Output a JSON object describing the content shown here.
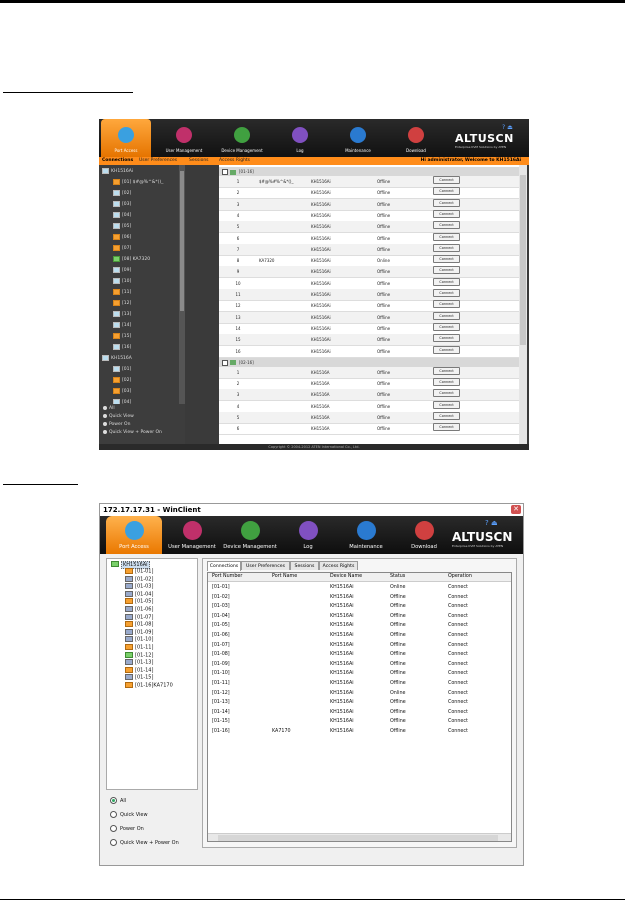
{
  "colors": {
    "accent": "#ff8c1a",
    "dark_bar": "#1a1a1a",
    "button_border": "#7a7a7a"
  },
  "headings": {
    "first": "",
    "second": ""
  },
  "browser": {
    "tabs": [
      {
        "label": "Port Access",
        "icon": "monitor-icon",
        "color": "#3aa0e0"
      },
      {
        "label": "User Management",
        "icon": "users-icon",
        "color": "#c0306a"
      },
      {
        "label": "Device Management",
        "icon": "device-icon",
        "color": "#40a040"
      },
      {
        "label": "Log",
        "icon": "log-icon",
        "color": "#8050c0"
      },
      {
        "label": "Maintenance",
        "icon": "maintenance-icon",
        "color": "#2a7ad0"
      },
      {
        "label": "Download",
        "icon": "download-icon",
        "color": "#d04040"
      }
    ],
    "logo": "ALTUSCN",
    "logo_tag": "Enterprise KVM Solutions by ATEN",
    "subtabs": [
      "Connections",
      "User Preferences",
      "Sessions",
      "Access Rights"
    ],
    "welcome": "Hi administrator, Welcome to KH1516Ai",
    "tree": [
      {
        "label": "KH1516Ai",
        "type": "root"
      },
      {
        "label": "[01] $#@%^&*()_",
        "type": "or"
      },
      {
        "label": "[02]",
        "type": "pc"
      },
      {
        "label": "[03]",
        "type": "pc"
      },
      {
        "label": "[04]",
        "type": "pc"
      },
      {
        "label": "[05]",
        "type": "pc"
      },
      {
        "label": "[06]",
        "type": "or"
      },
      {
        "label": "[07]",
        "type": "or"
      },
      {
        "label": "[08] KA7320",
        "type": "gr"
      },
      {
        "label": "[09]",
        "type": "pc"
      },
      {
        "label": "[10]",
        "type": "pc"
      },
      {
        "label": "[11]",
        "type": "or"
      },
      {
        "label": "[12]",
        "type": "or"
      },
      {
        "label": "[13]",
        "type": "pc"
      },
      {
        "label": "[14]",
        "type": "pc"
      },
      {
        "label": "[15]",
        "type": "or"
      },
      {
        "label": "[16]",
        "type": "pc"
      },
      {
        "label": "KH1516A",
        "type": "root"
      },
      {
        "label": "[01]",
        "type": "pc"
      },
      {
        "label": "[02]",
        "type": "or"
      },
      {
        "label": "[03]",
        "type": "or"
      },
      {
        "label": "[04]",
        "type": "pc"
      }
    ],
    "radios": [
      "All",
      "Quick View",
      "Power On",
      "Quick View + Power On"
    ],
    "group1": "[01-16]",
    "group2": "[02-16]",
    "rows1": [
      {
        "port": "1",
        "name": "$#@%#%^&*()_",
        "device": "KH1516Ai",
        "status": "Offline",
        "op": "Connect"
      },
      {
        "port": "2",
        "name": "",
        "device": "KH1516Ai",
        "status": "Offline",
        "op": "Connect"
      },
      {
        "port": "3",
        "name": "",
        "device": "KH1516Ai",
        "status": "Offline",
        "op": "Connect"
      },
      {
        "port": "4",
        "name": "",
        "device": "KH1516Ai",
        "status": "Offline",
        "op": "Connect"
      },
      {
        "port": "5",
        "name": "",
        "device": "KH1516Ai",
        "status": "Offline",
        "op": "Connect"
      },
      {
        "port": "6",
        "name": "",
        "device": "KH1516Ai",
        "status": "Offline",
        "op": "Connect"
      },
      {
        "port": "7",
        "name": "",
        "device": "KH1516Ai",
        "status": "Offline",
        "op": "Connect"
      },
      {
        "port": "8",
        "name": "KA7320",
        "device": "KH1516Ai",
        "status": "Online",
        "op": "Connect"
      },
      {
        "port": "9",
        "name": "",
        "device": "KH1516Ai",
        "status": "Offline",
        "op": "Connect"
      },
      {
        "port": "10",
        "name": "",
        "device": "KH1516Ai",
        "status": "Offline",
        "op": "Connect"
      },
      {
        "port": "11",
        "name": "",
        "device": "KH1516Ai",
        "status": "Offline",
        "op": "Connect"
      },
      {
        "port": "12",
        "name": "",
        "device": "KH1516Ai",
        "status": "Offline",
        "op": "Connect"
      },
      {
        "port": "13",
        "name": "",
        "device": "KH1516Ai",
        "status": "Offline",
        "op": "Connect"
      },
      {
        "port": "14",
        "name": "",
        "device": "KH1516Ai",
        "status": "Offline",
        "op": "Connect"
      },
      {
        "port": "15",
        "name": "",
        "device": "KH1516Ai",
        "status": "Offline",
        "op": "Connect"
      },
      {
        "port": "16",
        "name": "",
        "device": "KH1516Ai",
        "status": "Offline",
        "op": "Connect"
      }
    ],
    "rows2": [
      {
        "port": "1",
        "name": "",
        "device": "KH1516A",
        "status": "Offline",
        "op": "Connect"
      },
      {
        "port": "2",
        "name": "",
        "device": "KH1516A",
        "status": "Offline",
        "op": "Connect"
      },
      {
        "port": "3",
        "name": "",
        "device": "KH1516A",
        "status": "Offline",
        "op": "Connect"
      },
      {
        "port": "4",
        "name": "",
        "device": "KH1516A",
        "status": "Offline",
        "op": "Connect"
      },
      {
        "port": "5",
        "name": "",
        "device": "KH1516A",
        "status": "Offline",
        "op": "Connect"
      },
      {
        "port": "6",
        "name": "",
        "device": "KH1516A",
        "status": "Offline",
        "op": "Connect"
      }
    ],
    "footer": "Copyright © 2004-2012 ATEN International Co., Ltd."
  },
  "winclient": {
    "title": "172.17.17.31 - WinClient",
    "tabs": [
      {
        "label": "Port Access",
        "icon": "monitor-icon",
        "color": "#3aa0e0"
      },
      {
        "label": "User Management",
        "icon": "users-icon",
        "color": "#c0306a"
      },
      {
        "label": "Device Management",
        "icon": "device-icon",
        "color": "#40a040"
      },
      {
        "label": "Log",
        "icon": "log-icon",
        "color": "#8050c0"
      },
      {
        "label": "Maintenance",
        "icon": "maintenance-icon",
        "color": "#2a7ad0"
      },
      {
        "label": "Download",
        "icon": "download-icon",
        "color": "#d04040"
      }
    ],
    "logo": "ALTUSCN",
    "logo_tag": "Enterprise KVM Solutions by ATEN",
    "tree_root": "KH1516Ai",
    "tree": [
      {
        "label": "[01-01]",
        "type": "or"
      },
      {
        "label": "[01-02]",
        "type": "pc"
      },
      {
        "label": "[01-03]",
        "type": "pc"
      },
      {
        "label": "[01-04]",
        "type": "pc"
      },
      {
        "label": "[01-05]",
        "type": "or"
      },
      {
        "label": "[01-06]",
        "type": "pc"
      },
      {
        "label": "[01-07]",
        "type": "pc"
      },
      {
        "label": "[01-08]",
        "type": "or"
      },
      {
        "label": "[01-09]",
        "type": "pc"
      },
      {
        "label": "[01-10]",
        "type": "pc"
      },
      {
        "label": "[01-11]",
        "type": "or"
      },
      {
        "label": "[01-12]",
        "type": "gr"
      },
      {
        "label": "[01-13]",
        "type": "pc"
      },
      {
        "label": "[01-14]",
        "type": "or"
      },
      {
        "label": "[01-15]",
        "type": "pc"
      },
      {
        "label": "[01-16]KA7170",
        "type": "or"
      }
    ],
    "radios": [
      "All",
      "Quick View",
      "Power On",
      "Quick View + Power On"
    ],
    "subtabs": [
      "Connections",
      "User Preferences",
      "Sessions",
      "Access Rights"
    ],
    "columns": [
      "Port Number",
      "Port Name",
      "Device Name",
      "Status",
      "Operation"
    ],
    "rows": [
      {
        "port": "[01-01]",
        "name": "",
        "device": "KH1516Ai",
        "status": "Online",
        "op": "Connect"
      },
      {
        "port": "[01-02]",
        "name": "",
        "device": "KH1516Ai",
        "status": "Offline",
        "op": "Connect"
      },
      {
        "port": "[01-03]",
        "name": "",
        "device": "KH1516Ai",
        "status": "Offline",
        "op": "Connect"
      },
      {
        "port": "[01-04]",
        "name": "",
        "device": "KH1516Ai",
        "status": "Offline",
        "op": "Connect"
      },
      {
        "port": "[01-05]",
        "name": "",
        "device": "KH1516Ai",
        "status": "Offline",
        "op": "Connect"
      },
      {
        "port": "[01-06]",
        "name": "",
        "device": "KH1516Ai",
        "status": "Offline",
        "op": "Connect"
      },
      {
        "port": "[01-07]",
        "name": "",
        "device": "KH1516Ai",
        "status": "Offline",
        "op": "Connect"
      },
      {
        "port": "[01-08]",
        "name": "",
        "device": "KH1516Ai",
        "status": "Offline",
        "op": "Connect"
      },
      {
        "port": "[01-09]",
        "name": "",
        "device": "KH1516Ai",
        "status": "Offline",
        "op": "Connect"
      },
      {
        "port": "[01-10]",
        "name": "",
        "device": "KH1516Ai",
        "status": "Offline",
        "op": "Connect"
      },
      {
        "port": "[01-11]",
        "name": "",
        "device": "KH1516Ai",
        "status": "Offline",
        "op": "Connect"
      },
      {
        "port": "[01-12]",
        "name": "",
        "device": "KH1516Ai",
        "status": "Online",
        "op": "Connect"
      },
      {
        "port": "[01-13]",
        "name": "",
        "device": "KH1516Ai",
        "status": "Offline",
        "op": "Connect"
      },
      {
        "port": "[01-14]",
        "name": "",
        "device": "KH1516Ai",
        "status": "Offline",
        "op": "Connect"
      },
      {
        "port": "[01-15]",
        "name": "",
        "device": "KH1516Ai",
        "status": "Offline",
        "op": "Connect"
      },
      {
        "port": "[01-16]",
        "name": "KA7170",
        "device": "KH1516Ai",
        "status": "Offline",
        "op": "Connect"
      }
    ]
  }
}
